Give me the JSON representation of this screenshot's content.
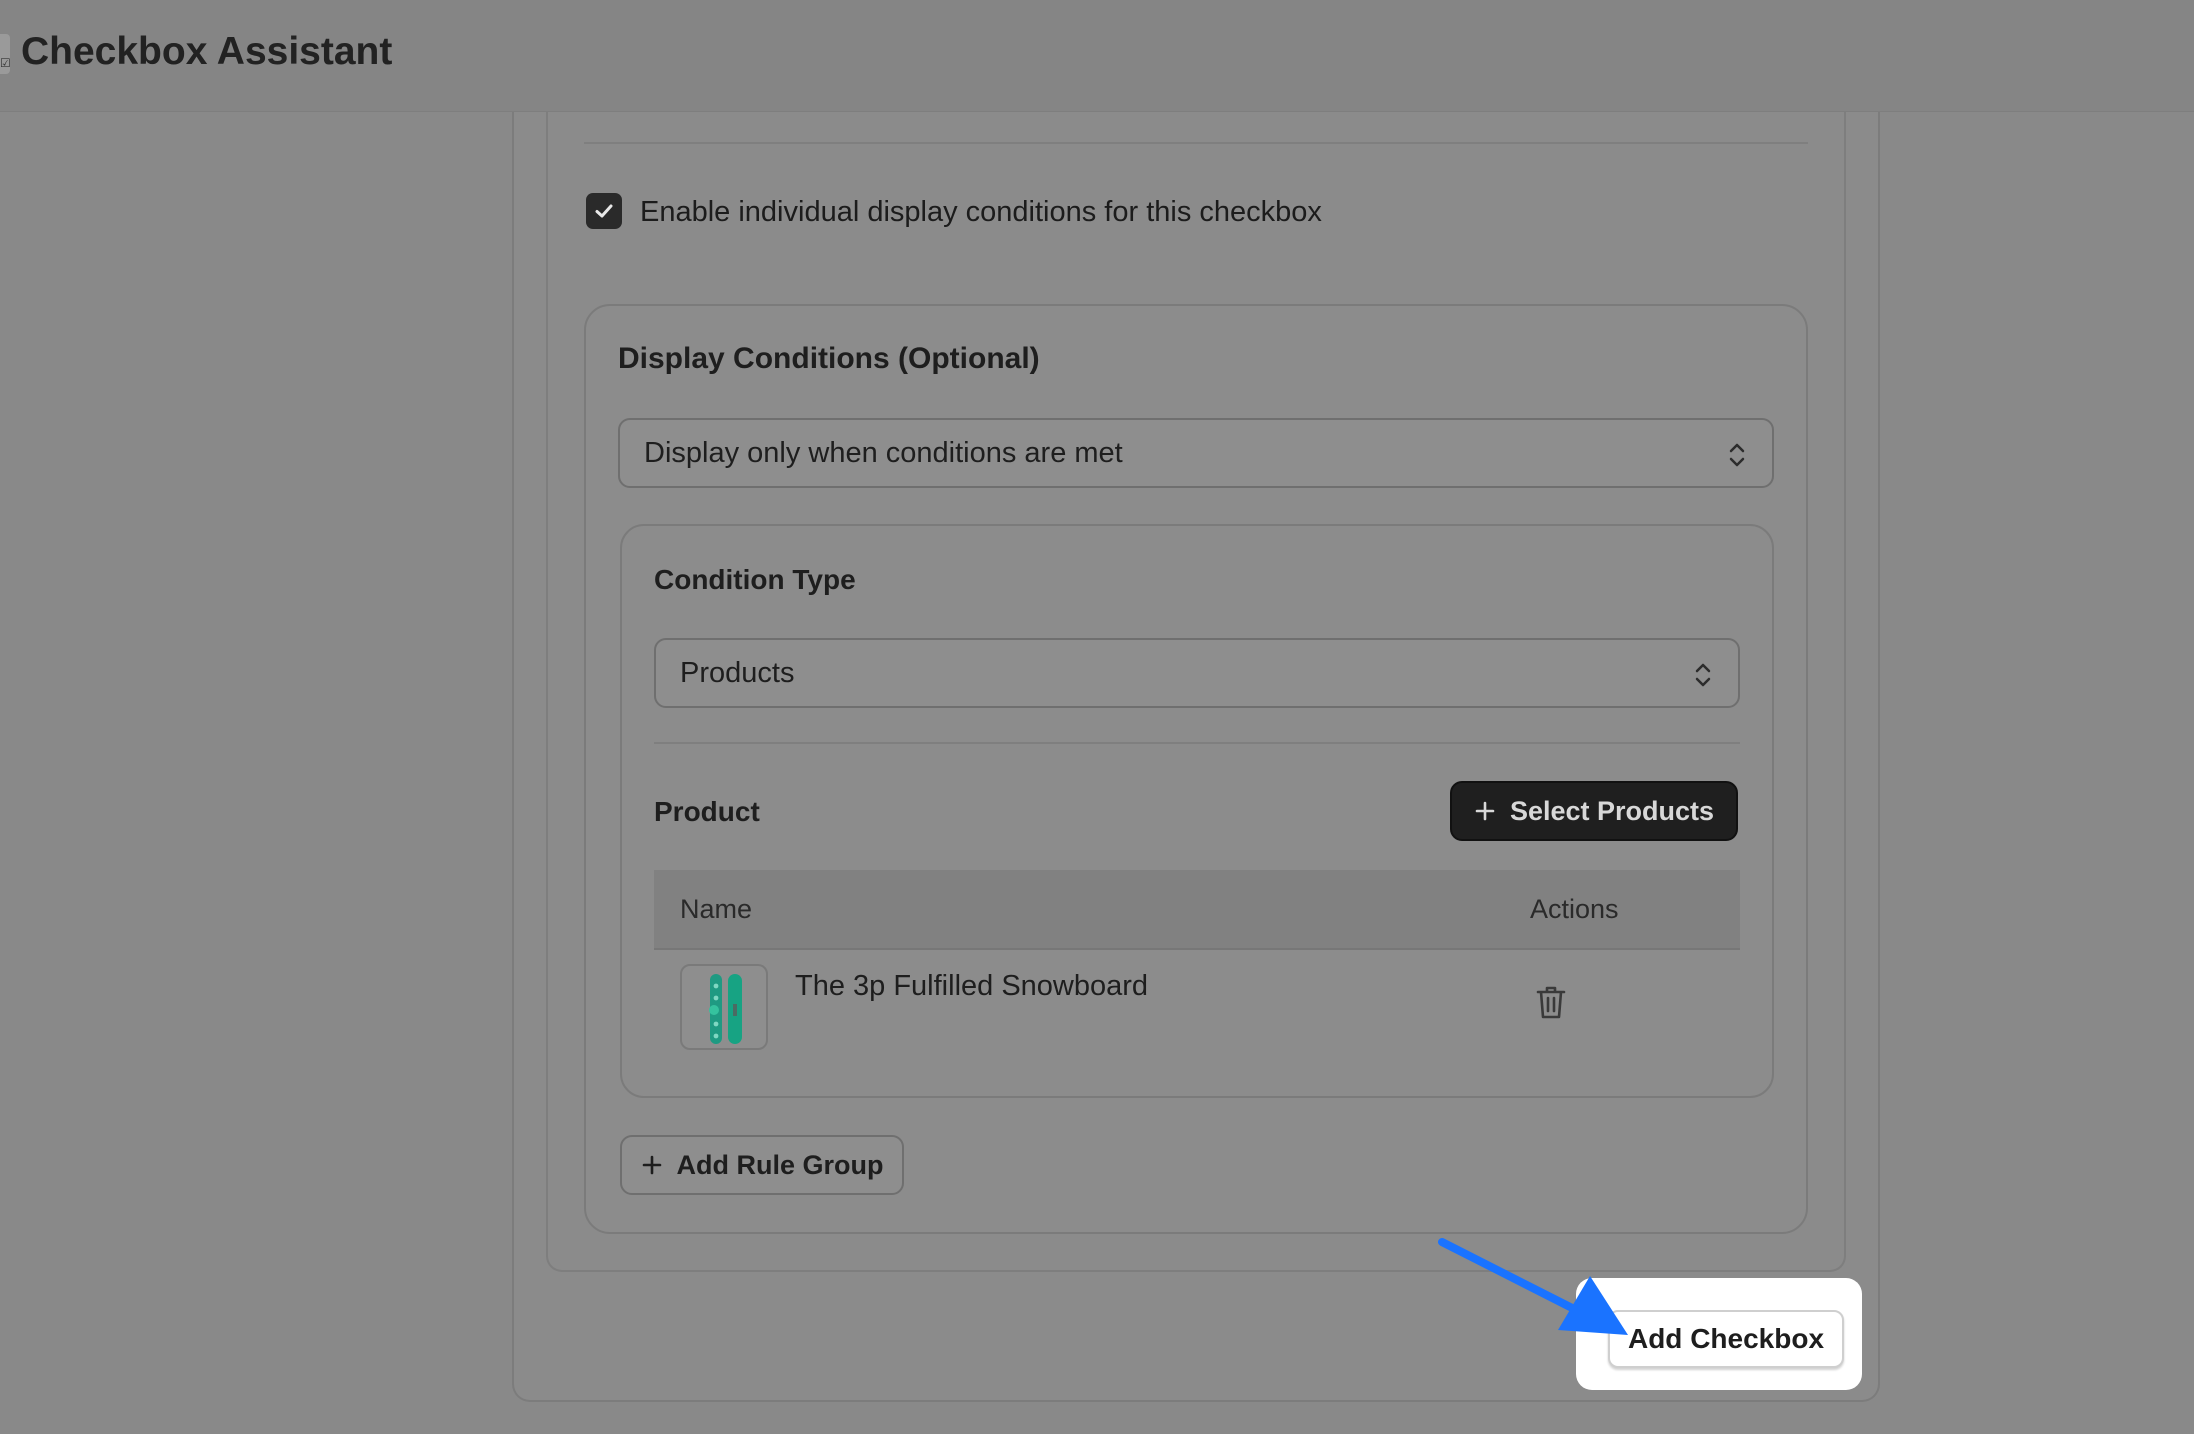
{
  "header": {
    "title": "Checkbox Assistant",
    "icon_glyph": "☑"
  },
  "settings": {
    "enable_conditions_label": "Enable individual display conditions for this checkbox",
    "enable_conditions_checked": true
  },
  "display_conditions": {
    "title": "Display Conditions (Optional)",
    "mode_value": "Display only when conditions are met",
    "rule_group": {
      "condition_type_label": "Condition Type",
      "condition_type_value": "Products",
      "product_label": "Product",
      "select_products_label": "Select Products",
      "table": {
        "columns": [
          "Name",
          "Actions"
        ],
        "rows": [
          {
            "name": "The 3p Fulfilled Snowboard",
            "thumbnail": "snowboard-thumbnail",
            "action_icon": "trash-icon"
          }
        ]
      }
    },
    "add_rule_group_label": "Add Rule Group"
  },
  "footer": {
    "add_checkbox_label": "Add Checkbox"
  },
  "colors": {
    "accent_arrow": "#1a73ff",
    "dark_button": "#1f1f1f",
    "overlay": "#898989",
    "snowboard_teal": "#1aa88a"
  }
}
